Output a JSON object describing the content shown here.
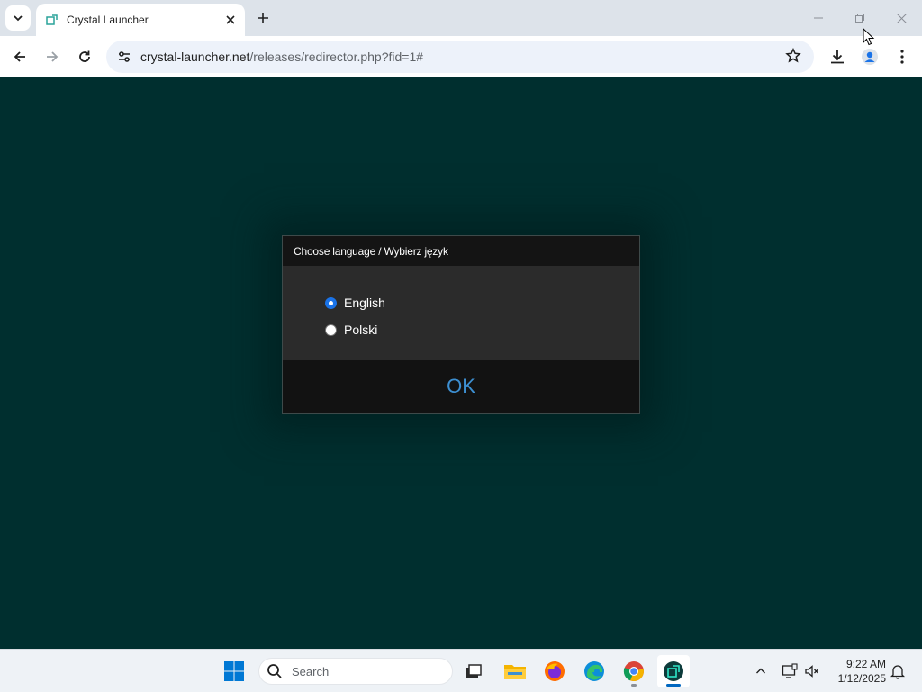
{
  "browser": {
    "tab": {
      "title": "Crystal Launcher",
      "favicon": "crystal-launcher-icon"
    },
    "address_bar": {
      "host": "crystal-launcher.net",
      "path": "/releases/redirector.php?fid=1#"
    }
  },
  "dialog": {
    "title": "Choose language / Wybierz język",
    "options": [
      {
        "label": "English",
        "selected": true
      },
      {
        "label": "Polski",
        "selected": false
      }
    ],
    "ok_label": "OK"
  },
  "taskbar": {
    "search_placeholder": "Search",
    "time": "9:22 AM",
    "date": "1/12/2025"
  },
  "colors": {
    "page_background": "#002f2f",
    "ok_text": "#3d8fd1",
    "radio_selected": "#1a73e8"
  }
}
